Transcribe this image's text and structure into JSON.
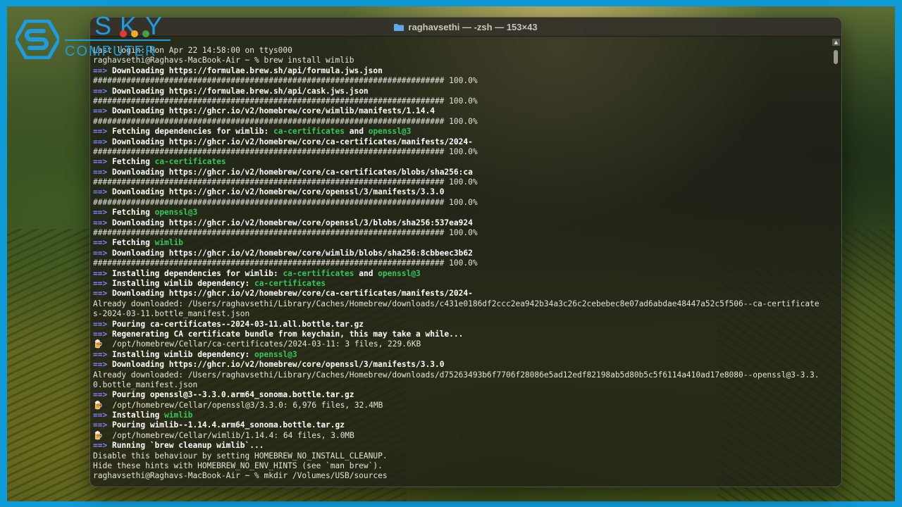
{
  "logo": {
    "word1": "SKY",
    "word2": "COMPUTER"
  },
  "window": {
    "title": "raghavsethi — -zsh — 153×43"
  },
  "terminal": {
    "lines": [
      [
        {
          "t": "Last login: Mon Apr 22 14:58:00 on ttys000",
          "c": ""
        }
      ],
      [
        {
          "t": "raghavsethi@Raghavs-MacBook-Air ~ % brew install wimlib",
          "c": ""
        }
      ],
      [
        {
          "t": "==> ",
          "c": "arrow"
        },
        {
          "t": "Downloading https://formulae.brew.sh/api/formula.jws.json",
          "c": "b"
        }
      ],
      [
        {
          "t": "########################################################################## 100.0%",
          "c": ""
        }
      ],
      [
        {
          "t": "==> ",
          "c": "arrow"
        },
        {
          "t": "Downloading https://formulae.brew.sh/api/cask.jws.json",
          "c": "b"
        }
      ],
      [
        {
          "t": "########################################################################## 100.0%",
          "c": ""
        }
      ],
      [
        {
          "t": "==> ",
          "c": "arrow"
        },
        {
          "t": "Downloading https://ghcr.io/v2/homebrew/core/wimlib/manifests/1.14.4",
          "c": "b"
        }
      ],
      [
        {
          "t": "########################################################################## 100.0%",
          "c": ""
        }
      ],
      [
        {
          "t": "==> ",
          "c": "arrow"
        },
        {
          "t": "Fetching dependencies for wimlib: ",
          "c": "b"
        },
        {
          "t": "ca-certificates",
          "c": "g"
        },
        {
          "t": " and ",
          "c": "b"
        },
        {
          "t": "openssl@3",
          "c": "g"
        }
      ],
      [
        {
          "t": "==> ",
          "c": "arrow"
        },
        {
          "t": "Downloading https://ghcr.io/v2/homebrew/core/ca-certificates/manifests/2024-",
          "c": "b"
        }
      ],
      [
        {
          "t": "########################################################################## 100.0%",
          "c": ""
        }
      ],
      [
        {
          "t": "==> ",
          "c": "arrow"
        },
        {
          "t": "Fetching ",
          "c": "b"
        },
        {
          "t": "ca-certificates",
          "c": "g"
        }
      ],
      [
        {
          "t": "==> ",
          "c": "arrow"
        },
        {
          "t": "Downloading https://ghcr.io/v2/homebrew/core/ca-certificates/blobs/sha256:ca",
          "c": "b"
        }
      ],
      [
        {
          "t": "########################################################################## 100.0%",
          "c": ""
        }
      ],
      [
        {
          "t": "==> ",
          "c": "arrow"
        },
        {
          "t": "Downloading https://ghcr.io/v2/homebrew/core/openssl/3/manifests/3.3.0",
          "c": "b"
        }
      ],
      [
        {
          "t": "########################################################################## 100.0%",
          "c": ""
        }
      ],
      [
        {
          "t": "==> ",
          "c": "arrow"
        },
        {
          "t": "Fetching ",
          "c": "b"
        },
        {
          "t": "openssl@3",
          "c": "g"
        }
      ],
      [
        {
          "t": "==> ",
          "c": "arrow"
        },
        {
          "t": "Downloading https://ghcr.io/v2/homebrew/core/openssl/3/blobs/sha256:537ea924",
          "c": "b"
        }
      ],
      [
        {
          "t": "########################################################################## 100.0%",
          "c": ""
        }
      ],
      [
        {
          "t": "==> ",
          "c": "arrow"
        },
        {
          "t": "Fetching ",
          "c": "b"
        },
        {
          "t": "wimlib",
          "c": "g"
        }
      ],
      [
        {
          "t": "==> ",
          "c": "arrow"
        },
        {
          "t": "Downloading https://ghcr.io/v2/homebrew/core/wimlib/blobs/sha256:8cbbeec3b62",
          "c": "b"
        }
      ],
      [
        {
          "t": "########################################################################## 100.0%",
          "c": ""
        }
      ],
      [
        {
          "t": "==> ",
          "c": "arrow"
        },
        {
          "t": "Installing dependencies for wimlib: ",
          "c": "b"
        },
        {
          "t": "ca-certificates",
          "c": "g"
        },
        {
          "t": " and ",
          "c": "b"
        },
        {
          "t": "openssl@3",
          "c": "g"
        }
      ],
      [
        {
          "t": "==> ",
          "c": "arrow"
        },
        {
          "t": "Installing wimlib dependency: ",
          "c": "b"
        },
        {
          "t": "ca-certificates",
          "c": "g"
        }
      ],
      [
        {
          "t": "==> ",
          "c": "arrow"
        },
        {
          "t": "Downloading https://ghcr.io/v2/homebrew/core/ca-certificates/manifests/2024-",
          "c": "b"
        }
      ],
      [
        {
          "t": "Already downloaded: /Users/raghavsethi/Library/Caches/Homebrew/downloads/c431e0186df2ccc2ea942b34a3c26c2cebebec8e07ad6abdae48447a52c5f506--ca-certificate",
          "c": ""
        }
      ],
      [
        {
          "t": "s-2024-03-11.bottle_manifest.json",
          "c": ""
        }
      ],
      [
        {
          "t": "==> ",
          "c": "arrow"
        },
        {
          "t": "Pouring ca-certificates--2024-03-11.all.bottle.tar.gz",
          "c": "b"
        }
      ],
      [
        {
          "t": "==> ",
          "c": "arrow"
        },
        {
          "t": "Regenerating CA certificate bundle from keychain, this may take a while...",
          "c": "b"
        }
      ],
      [
        {
          "t": "🍺  /opt/homebrew/Cellar/ca-certificates/2024-03-11: 3 files, 229.6KB",
          "c": ""
        }
      ],
      [
        {
          "t": "==> ",
          "c": "arrow"
        },
        {
          "t": "Installing wimlib dependency: ",
          "c": "b"
        },
        {
          "t": "openssl@3",
          "c": "g"
        }
      ],
      [
        {
          "t": "==> ",
          "c": "arrow"
        },
        {
          "t": "Downloading https://ghcr.io/v2/homebrew/core/openssl/3/manifests/3.3.0",
          "c": "b"
        }
      ],
      [
        {
          "t": "Already downloaded: /Users/raghavsethi/Library/Caches/Homebrew/downloads/d75263493b6f7706f28086e5ad12edf82198ab5d80b5c5f6114a410ad17e8080--openssl@3-3.3.",
          "c": ""
        }
      ],
      [
        {
          "t": "0.bottle_manifest.json",
          "c": ""
        }
      ],
      [
        {
          "t": "==> ",
          "c": "arrow"
        },
        {
          "t": "Pouring openssl@3--3.3.0.arm64_sonoma.bottle.tar.gz",
          "c": "b"
        }
      ],
      [
        {
          "t": "🍺  /opt/homebrew/Cellar/openssl@3/3.3.0: 6,976 files, 32.4MB",
          "c": ""
        }
      ],
      [
        {
          "t": "==> ",
          "c": "arrow"
        },
        {
          "t": "Installing ",
          "c": "b"
        },
        {
          "t": "wimlib",
          "c": "g"
        }
      ],
      [
        {
          "t": "==> ",
          "c": "arrow"
        },
        {
          "t": "Pouring wimlib--1.14.4.arm64_sonoma.bottle.tar.gz",
          "c": "b"
        }
      ],
      [
        {
          "t": "🍺  /opt/homebrew/Cellar/wimlib/1.14.4: 64 files, 3.0MB",
          "c": ""
        }
      ],
      [
        {
          "t": "==> ",
          "c": "arrow"
        },
        {
          "t": "Running `brew cleanup wimlib`...",
          "c": "b"
        }
      ],
      [
        {
          "t": "Disable this behaviour by setting HOMEBREW_NO_INSTALL_CLEANUP.",
          "c": ""
        }
      ],
      [
        {
          "t": "Hide these hints with HOMEBREW_NO_ENV_HINTS (see `man brew`).",
          "c": ""
        }
      ],
      [
        {
          "t": "raghavsethi@Raghavs-MacBook-Air ~ % mkdir /Volumes/USB/sources",
          "c": ""
        }
      ]
    ]
  },
  "colors": {
    "arrow": "#7e87ff",
    "highlight_green": "#34c759",
    "text": "#e4e4dc",
    "frame_border": "#0f9ad8",
    "logo_blue": "#1d9ce0",
    "logo_dots": [
      "#e53935",
      "#f9a825",
      "#43a047"
    ]
  },
  "icons": {
    "title": "folder-icon",
    "scroll": "scroll-up-arrow-icon"
  }
}
